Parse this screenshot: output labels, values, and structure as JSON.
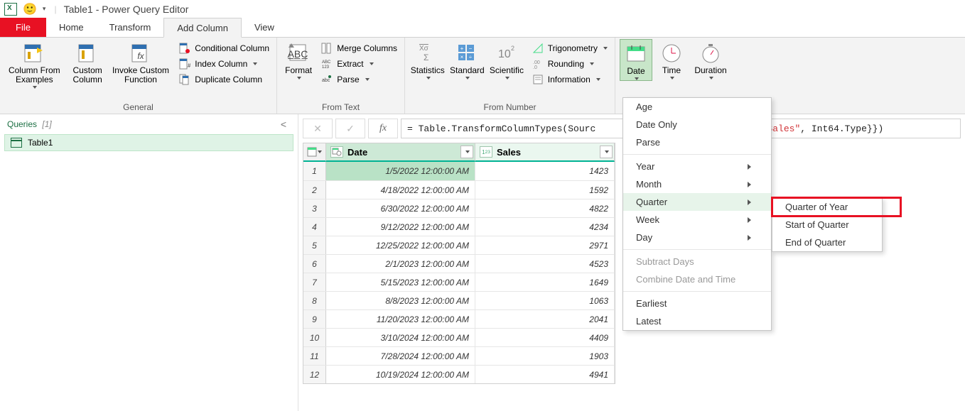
{
  "titlebar": {
    "title": "Table1 - Power Query Editor",
    "smiley": "🙂",
    "qat_drop": "▾",
    "divider": "|"
  },
  "tabs": {
    "file": "File",
    "home": "Home",
    "transform": "Transform",
    "add": "Add Column",
    "view": "View"
  },
  "ribbon": {
    "general": {
      "label": "General",
      "col_from_examples": "Column From\nExamples",
      "custom_col": "Custom\nColumn",
      "invoke": "Invoke Custom\nFunction",
      "conditional": "Conditional Column",
      "index": "Index Column",
      "duplicate": "Duplicate Column"
    },
    "from_text": {
      "label": "From Text",
      "format": "Format",
      "merge": "Merge Columns",
      "extract": "Extract",
      "parse": "Parse"
    },
    "from_number": {
      "label": "From Number",
      "stats": "Statistics",
      "standard": "Standard",
      "scientific": "Scientific",
      "trig": "Trigonometry",
      "rounding": "Rounding",
      "info": "Information"
    },
    "datetime": {
      "date": "Date",
      "time": "Time",
      "duration": "Duration"
    }
  },
  "side": {
    "header": "Queries",
    "count": "[1]",
    "query1": "Table1",
    "collapse": "<"
  },
  "formula": {
    "x": "✕",
    "check": "✓",
    "fx": "fx",
    "pre": "= Table.TransformColumnTypes(Sourc",
    "mid": ", {",
    "str_sales": "\"Sales\"",
    "post": ", Int64.Type}})"
  },
  "grid": {
    "col_date": "Date",
    "col_sales": "Sales",
    "type_date": "📅",
    "type_int_1": "1",
    "type_int_2": "2",
    "type_int_3": "3",
    "rows": [
      {
        "n": "1",
        "date": "1/5/2022 12:00:00 AM",
        "sales": "1423"
      },
      {
        "n": "2",
        "date": "4/18/2022 12:00:00 AM",
        "sales": "1592"
      },
      {
        "n": "3",
        "date": "6/30/2022 12:00:00 AM",
        "sales": "4822"
      },
      {
        "n": "4",
        "date": "9/12/2022 12:00:00 AM",
        "sales": "4234"
      },
      {
        "n": "5",
        "date": "12/25/2022 12:00:00 AM",
        "sales": "2971"
      },
      {
        "n": "6",
        "date": "2/1/2023 12:00:00 AM",
        "sales": "4523"
      },
      {
        "n": "7",
        "date": "5/15/2023 12:00:00 AM",
        "sales": "1649"
      },
      {
        "n": "8",
        "date": "8/8/2023 12:00:00 AM",
        "sales": "1063"
      },
      {
        "n": "9",
        "date": "11/20/2023 12:00:00 AM",
        "sales": "2041"
      },
      {
        "n": "10",
        "date": "3/10/2024 12:00:00 AM",
        "sales": "4409"
      },
      {
        "n": "11",
        "date": "7/28/2024 12:00:00 AM",
        "sales": "1903"
      },
      {
        "n": "12",
        "date": "10/19/2024 12:00:00 AM",
        "sales": "4941"
      }
    ]
  },
  "date_menu": {
    "age": "Age",
    "date_only": "Date Only",
    "parse": "Parse",
    "year": "Year",
    "month": "Month",
    "quarter": "Quarter",
    "week": "Week",
    "day": "Day",
    "subtract": "Subtract Days",
    "combine": "Combine Date and Time",
    "earliest": "Earliest",
    "latest": "Latest"
  },
  "quarter_menu": {
    "qoy": "Quarter of Year",
    "start": "Start of Quarter",
    "end": "End of Quarter"
  }
}
